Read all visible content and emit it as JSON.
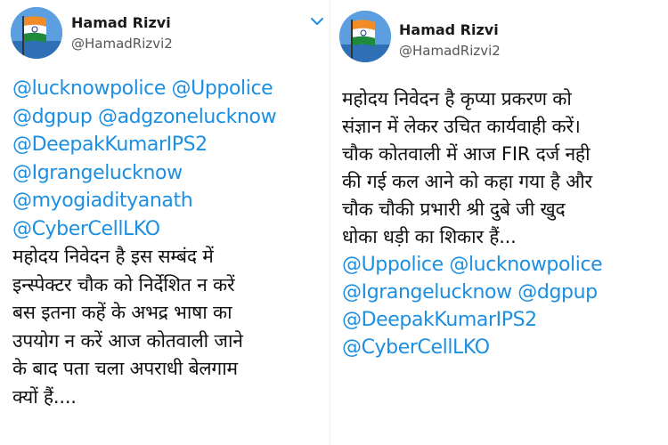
{
  "tweets": [
    {
      "author": {
        "name": "Hamad Rizvi",
        "handle": "@HamadRizvi2",
        "avatar_icon": "indian-flag-avatar"
      },
      "menu_icon": "chevron-down-icon",
      "lines": [
        {
          "text": "@lucknowpolice @Uppolice",
          "kind": "mention"
        },
        {
          "text": "@dgpup @adgzonelucknow",
          "kind": "mention"
        },
        {
          "text": "@DeepakKumarIPS2",
          "kind": "mention"
        },
        {
          "text": "@Igrangelucknow",
          "kind": "mention"
        },
        {
          "text": "@myogiadityanath",
          "kind": "mention"
        },
        {
          "text": "@CyberCellLKO",
          "kind": "mention"
        },
        {
          "text": "महोदय निवेदन है इस सम्बंद में",
          "kind": "text"
        },
        {
          "text": "इन्स्पेक्टर चौक को निर्देशित न करें",
          "kind": "text"
        },
        {
          "text": "बस इतना कहें के अभद्र भाषा का",
          "kind": "text"
        },
        {
          "text": "उपयोग न करें आज कोतवाली जाने",
          "kind": "text"
        },
        {
          "text": "के बाद पता चला अपराधी बेलगाम",
          "kind": "text"
        },
        {
          "text": "क्यों हैं....",
          "kind": "text"
        }
      ]
    },
    {
      "author": {
        "name": "Hamad Rizvi",
        "handle": "@HamadRizvi2",
        "avatar_icon": "indian-flag-avatar"
      },
      "lines": [
        {
          "text": "महोदय निवेदन है कृप्या प्रकरण को",
          "kind": "text"
        },
        {
          "text": "संज्ञान में लेकर उचित कार्यवाही करें।",
          "kind": "text"
        },
        {
          "text": "चौक कोतवाली में आज FIR दर्ज नही",
          "kind": "text"
        },
        {
          "text": "की गई कल आने को कहा गया है और",
          "kind": "text"
        },
        {
          "text": "चौक चौकी प्रभारी श्री दुबे जी खुद",
          "kind": "text"
        },
        {
          "text": "धोका धड़ी का शिकार हैं...",
          "kind": "text"
        },
        {
          "text": "@Uppolice @lucknowpolice",
          "kind": "mention"
        },
        {
          "text": "@Igrangelucknow @dgpup",
          "kind": "mention"
        },
        {
          "text": "@DeepakKumarIPS2",
          "kind": "mention"
        },
        {
          "text": "@CyberCellLKO",
          "kind": "mention"
        }
      ]
    }
  ],
  "colors": {
    "mention": "#1d8fe1",
    "text": "#111111",
    "name": "#1a1a1a",
    "handle": "#555555",
    "caret": "#1d8fe1"
  }
}
